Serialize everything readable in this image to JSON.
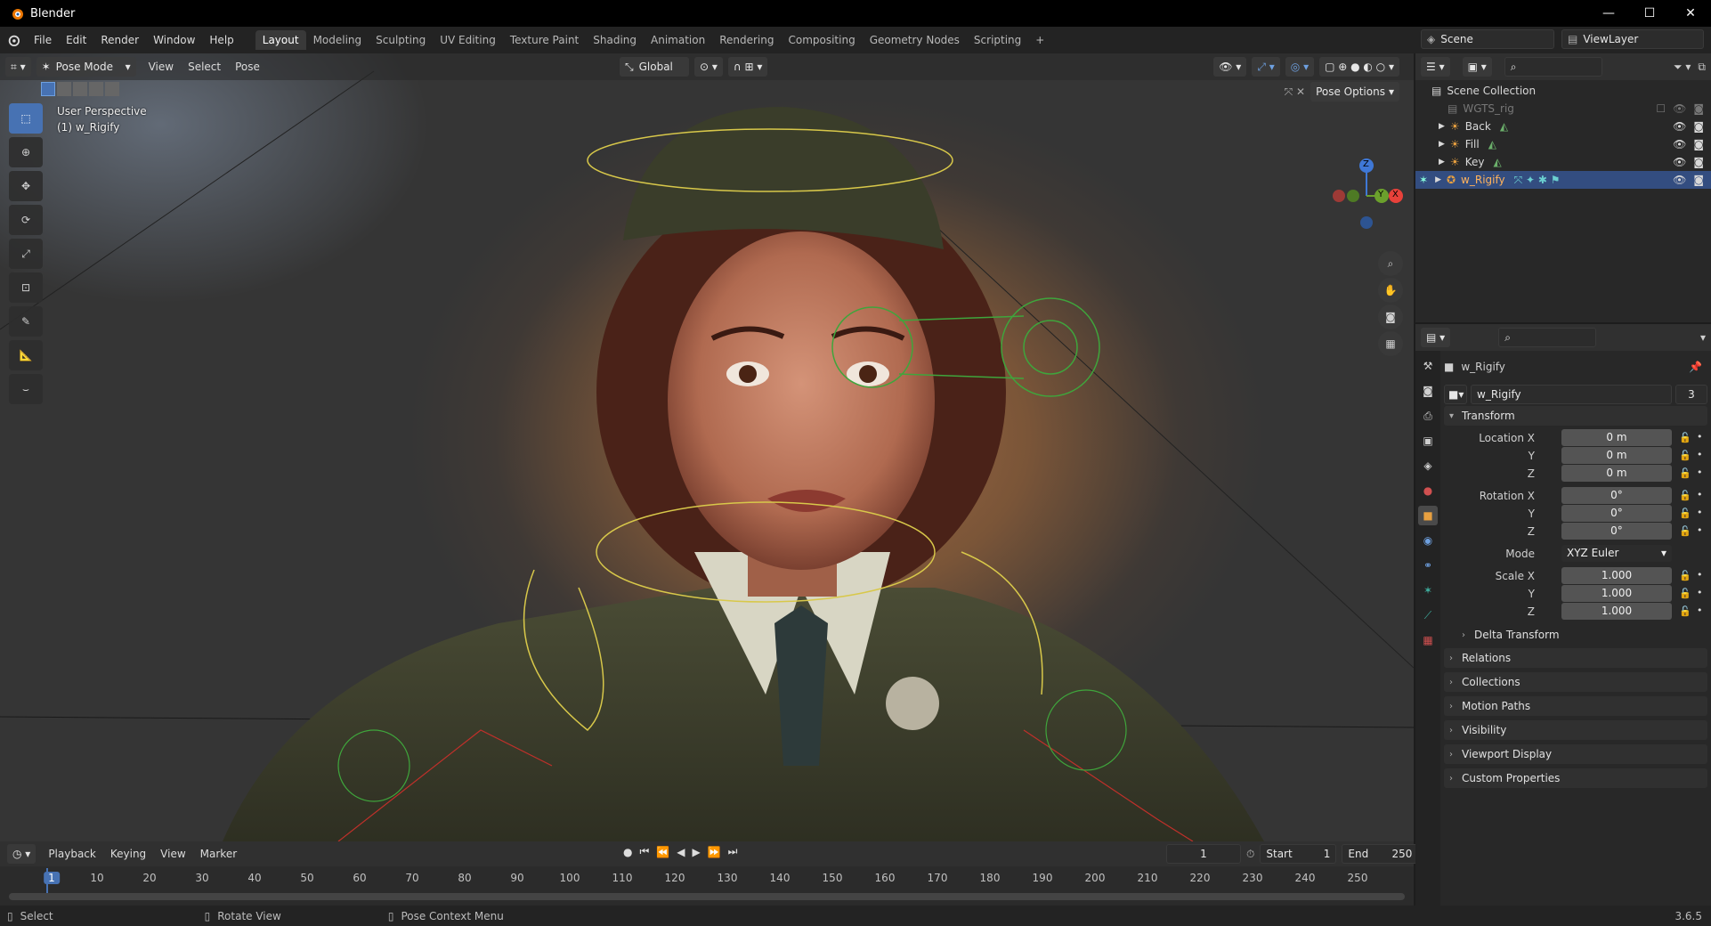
{
  "titlebar": {
    "app": "Blender",
    "minimize": "—",
    "maximize": "☐",
    "close": "✕"
  },
  "menubar": {
    "menus": [
      "File",
      "Edit",
      "Render",
      "Window",
      "Help"
    ],
    "workspaces": [
      "Layout",
      "Modeling",
      "Sculpting",
      "UV Editing",
      "Texture Paint",
      "Shading",
      "Animation",
      "Rendering",
      "Compositing",
      "Geometry Nodes",
      "Scripting"
    ],
    "add_tab": "+",
    "scene": "Scene",
    "view_layer": "ViewLayer"
  },
  "viewport": {
    "mode": "Pose Mode",
    "menus": [
      "View",
      "Select",
      "Pose"
    ],
    "orientation": "Global",
    "pose_options": "Pose Options",
    "info_line1": "User Perspective",
    "info_line2": "(1) w_Rigify",
    "gizmo": {
      "x": "X",
      "y": "Y",
      "z": "Z"
    }
  },
  "timeline": {
    "menus": [
      "Playback",
      "Keying",
      "View",
      "Marker"
    ],
    "current_frame": "1",
    "start_label": "Start",
    "start": "1",
    "end_label": "End",
    "end": "250",
    "ticks": [
      "1",
      "10",
      "20",
      "30",
      "40",
      "50",
      "60",
      "70",
      "80",
      "90",
      "100",
      "110",
      "120",
      "130",
      "140",
      "150",
      "160",
      "170",
      "180",
      "190",
      "200",
      "210",
      "220",
      "230",
      "240",
      "250"
    ]
  },
  "statusbar": {
    "select": "Select",
    "rotate": "Rotate View",
    "context": "Pose Context Menu",
    "version": "3.6.5"
  },
  "outliner": {
    "root": "Scene Collection",
    "items": [
      {
        "label": "WGTS_rig",
        "muted": true
      },
      {
        "label": "Back"
      },
      {
        "label": "Fill"
      },
      {
        "label": "Key"
      },
      {
        "label": "w_Rigify",
        "selected": true
      }
    ]
  },
  "properties": {
    "object_name": "w_Rigify",
    "data_name": "w_Rigify",
    "users": "3",
    "transform_title": "Transform",
    "location": {
      "label": "Location X",
      "x": "0 m",
      "y": "0 m",
      "z": "0 m"
    },
    "rotation": {
      "label": "Rotation X",
      "x": "0°",
      "y": "0°",
      "z": "0°"
    },
    "mode_label": "Mode",
    "mode_value": "XYZ Euler",
    "scale": {
      "label": "Scale X",
      "x": "1.000",
      "y": "1.000",
      "z": "1.000"
    },
    "axis_y": "Y",
    "axis_z": "Z",
    "delta": "Delta Transform",
    "panels": [
      "Relations",
      "Collections",
      "Motion Paths",
      "Visibility",
      "Viewport Display",
      "Custom Properties"
    ]
  },
  "colors": {
    "accent": "#4772b3",
    "selected_row": "#334d80",
    "x_axis": "#e8413a",
    "y_axis": "#6ba02c",
    "z_axis": "#3f78d6"
  }
}
